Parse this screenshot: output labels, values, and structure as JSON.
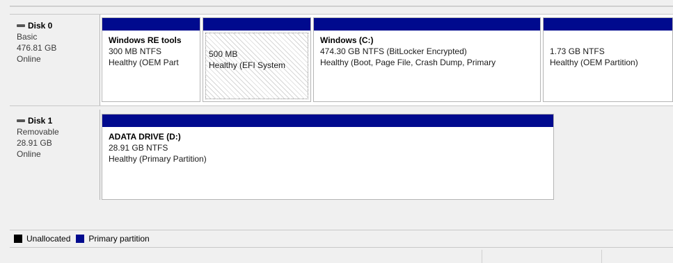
{
  "disks": [
    {
      "name": "Disk 0",
      "type": "Basic",
      "size": "476.81 GB",
      "status": "Online",
      "partitions": [
        {
          "name": "Windows RE tools",
          "detail": "300 MB NTFS",
          "health": "Healthy (OEM Part"
        },
        {
          "name": "",
          "detail": "500 MB",
          "health": "Healthy (EFI System"
        },
        {
          "name": "Windows  (C:)",
          "detail": "474.30 GB NTFS (BitLocker Encrypted)",
          "health": "Healthy (Boot, Page File, Crash Dump, Primary"
        },
        {
          "name": "",
          "detail": "1.73 GB NTFS",
          "health": "Healthy (OEM Partition)"
        }
      ]
    },
    {
      "name": "Disk 1",
      "type": "Removable",
      "size": "28.91 GB",
      "status": "Online",
      "partitions": [
        {
          "name": "ADATA DRIVE  (D:)",
          "detail": "28.91 GB NTFS",
          "health": "Healthy (Primary Partition)"
        }
      ]
    }
  ],
  "legend": {
    "unallocated_label": "Unallocated",
    "unallocated_color": "#000000",
    "primary_label": "Primary partition",
    "primary_color": "#000a8e"
  },
  "icons": {
    "disk": "disk-drive-icon"
  }
}
